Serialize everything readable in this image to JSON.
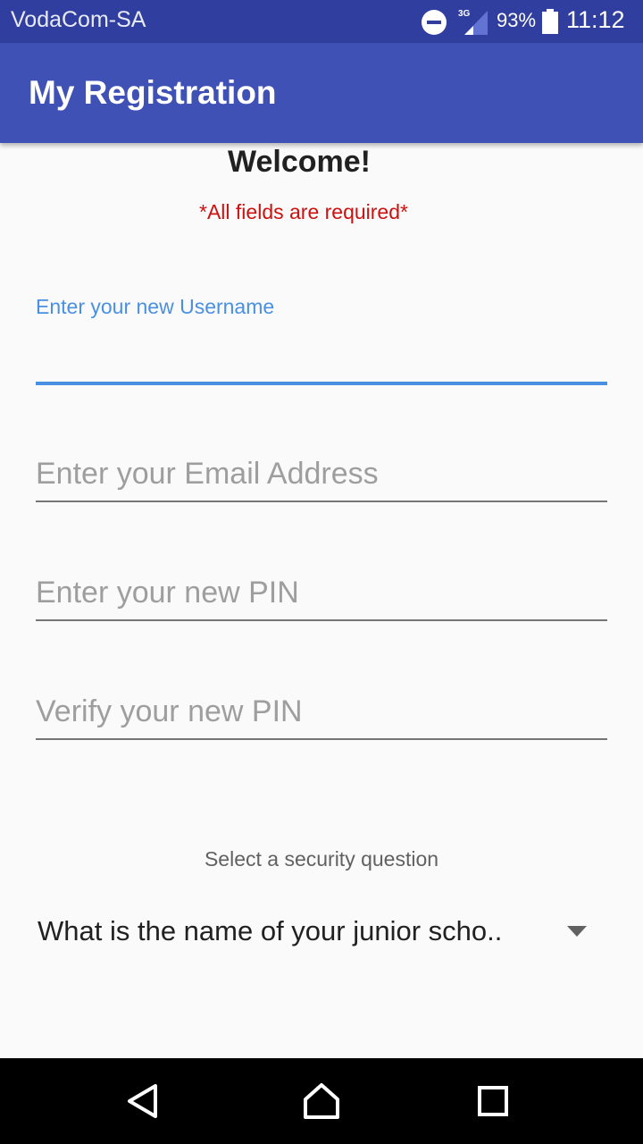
{
  "status_bar": {
    "carrier": "VodaCom-SA",
    "network_type": "3G",
    "battery_percent": "93%",
    "time": "11:12",
    "icons": [
      "do-not-disturb-icon",
      "signal-icon",
      "battery-icon"
    ]
  },
  "app_bar": {
    "title": "My Registration"
  },
  "form": {
    "welcome": "Welcome!",
    "required_note": "*All fields are required*",
    "username": {
      "label": "Enter your new Username",
      "value": ""
    },
    "email": {
      "placeholder": "Enter your Email Address",
      "value": ""
    },
    "pin": {
      "placeholder": "Enter your new PIN",
      "value": ""
    },
    "verify_pin": {
      "placeholder": "Verify your new PIN",
      "value": ""
    },
    "security": {
      "label": "Select a security question",
      "selected": "What is the name of your junior scho.."
    }
  },
  "nav_bar": {
    "icons": [
      "back-icon",
      "home-icon",
      "recents-icon"
    ]
  },
  "colors": {
    "status_bar": "#303f9f",
    "app_bar": "#3f51b5",
    "accent": "#4a90e2",
    "required_text": "#cc1111",
    "background": "#fafafa"
  }
}
